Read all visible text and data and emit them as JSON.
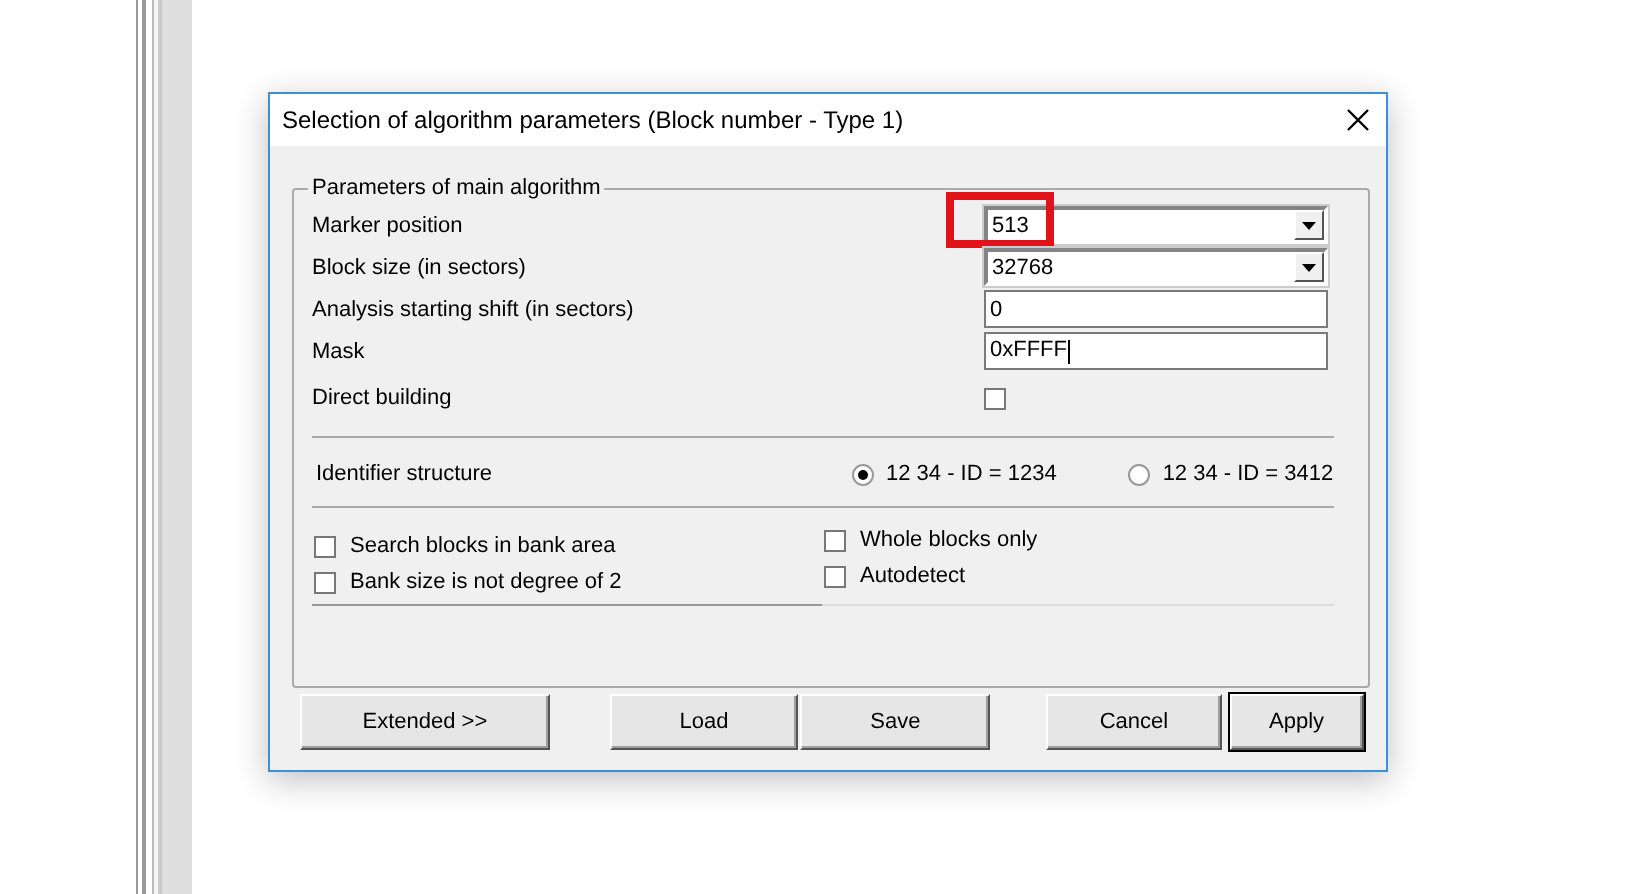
{
  "window": {
    "title": "Selection of algorithm parameters (Block number - Type 1)"
  },
  "group": {
    "title": "Parameters of main algorithm",
    "fields": [
      {
        "kind": "combo",
        "label": "Marker position",
        "value": "513",
        "highlighted": true
      },
      {
        "kind": "combo",
        "label": "Block size (in sectors)",
        "value": "32768",
        "highlighted": false
      },
      {
        "kind": "text",
        "label": "Analysis starting shift (in sectors)",
        "value": "0",
        "focused": false
      },
      {
        "kind": "text",
        "label": "Mask",
        "value": "0xFFFF",
        "focused": true
      },
      {
        "kind": "checkbox",
        "label": "Direct building",
        "checked": false
      }
    ],
    "identifier": {
      "label": "Identifier structure",
      "options": [
        {
          "label": "12 34 - ID = 1234",
          "selected": true
        },
        {
          "label": "12 34 - ID = 3412",
          "selected": false
        }
      ]
    },
    "options_left": [
      {
        "label": "Search blocks in bank area",
        "checked": false
      },
      {
        "label": "Bank size is not degree of 2",
        "checked": false
      }
    ],
    "options_right": [
      {
        "label": "Whole blocks only",
        "checked": false
      },
      {
        "label": "Autodetect",
        "checked": false
      }
    ]
  },
  "buttons": [
    {
      "label": "Extended >>",
      "default": false
    },
    {
      "label": "Load",
      "default": false
    },
    {
      "label": "Save",
      "default": false
    },
    {
      "label": "Cancel",
      "default": false
    },
    {
      "label": "Apply",
      "default": true
    }
  ]
}
